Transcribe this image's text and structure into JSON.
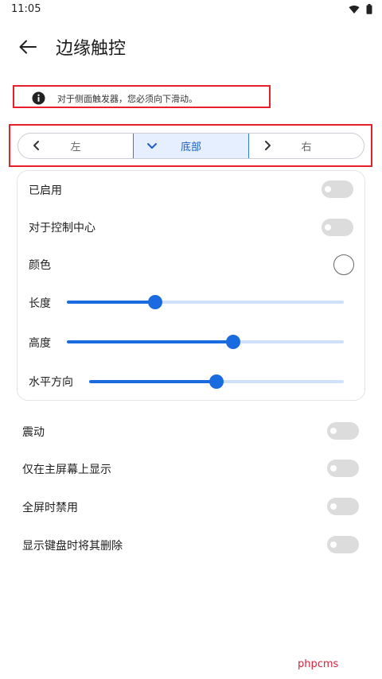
{
  "status_bar": {
    "time": "11:05"
  },
  "app_bar": {
    "title": "边缘触控",
    "back_icon": "arrow-left-icon"
  },
  "info_banner": {
    "text": "对于侧面触发器，您必须向下滑动。",
    "icon": "info-icon"
  },
  "position_selector": {
    "options": [
      {
        "label": "左",
        "icon": "chevron-left-icon",
        "selected": false
      },
      {
        "label": "底部",
        "icon": "chevron-down-icon",
        "selected": true
      },
      {
        "label": "右",
        "icon": "chevron-right-icon",
        "selected": false
      }
    ]
  },
  "card": {
    "enabled": {
      "label": "已启用",
      "on": false
    },
    "control_center": {
      "label": "对于控制中心",
      "on": false
    },
    "color": {
      "label": "颜色",
      "value": "#ffffff"
    },
    "length": {
      "label": "长度",
      "value": 0.32
    },
    "height": {
      "label": "高度",
      "value": 0.6
    },
    "horizontal": {
      "label": "水平方向",
      "value": 0.5
    }
  },
  "settings": [
    {
      "label": "震动",
      "on": false
    },
    {
      "label": "仅在主屏幕上显示",
      "on": false
    },
    {
      "label": "全屏时禁用",
      "on": false
    },
    {
      "label": "显示键盘时将其删除",
      "on": false
    }
  ],
  "watermark": "phpcms",
  "colors": {
    "accent": "#1a6be0",
    "selected_bg": "#e5efff",
    "highlight_border": "#e8202a"
  }
}
